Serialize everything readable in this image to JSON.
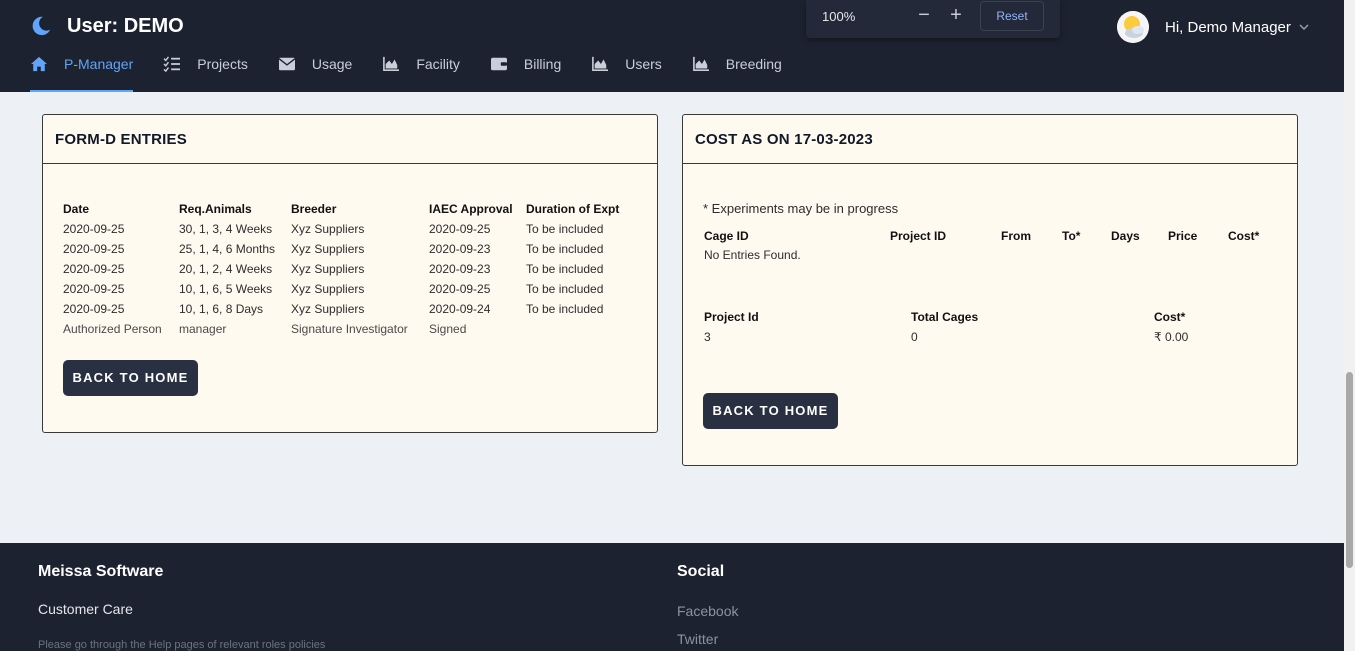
{
  "header": {
    "title": "User: DEMO",
    "greeting": "Hi, Demo Manager"
  },
  "zoom": {
    "value": "100%",
    "minus": "−",
    "plus": "+",
    "reset": "Reset"
  },
  "nav": {
    "items": [
      {
        "label": "P-Manager",
        "icon": "home-icon"
      },
      {
        "label": "Projects",
        "icon": "checklist-icon"
      },
      {
        "label": "Usage",
        "icon": "envelope-icon"
      },
      {
        "label": "Facility",
        "icon": "area-chart-icon"
      },
      {
        "label": "Billing",
        "icon": "wallet-icon"
      },
      {
        "label": "Users",
        "icon": "area-chart-icon"
      },
      {
        "label": "Breeding",
        "icon": "area-chart-icon"
      }
    ]
  },
  "form_d": {
    "title": "FORM-D ENTRIES",
    "columns": [
      "Date",
      "Req.Animals",
      "Breeder",
      "IAEC Approval",
      "Duration of Expt"
    ],
    "rows": [
      [
        "2020-09-25",
        "30, 1, 3, 4 Weeks",
        "Xyz Suppliers",
        "2020-09-25",
        "To be included"
      ],
      [
        "2020-09-25",
        "25, 1, 4, 6 Months",
        "Xyz Suppliers",
        "2020-09-23",
        "To be included"
      ],
      [
        "2020-09-25",
        "20, 1, 2, 4 Weeks",
        "Xyz Suppliers",
        "2020-09-23",
        "To be included"
      ],
      [
        "2020-09-25",
        "10, 1, 6, 5 Weeks",
        "Xyz Suppliers",
        "2020-09-25",
        "To be included"
      ],
      [
        "2020-09-25",
        "10, 1, 6, 8 Days",
        "Xyz Suppliers",
        "2020-09-24",
        "To be included"
      ]
    ],
    "auth_row": [
      "Authorized Person",
      "manager",
      "Signature Investigator",
      "Signed",
      ""
    ],
    "button": "BACK TO HOME"
  },
  "cost": {
    "title": "COST AS ON 17-03-2023",
    "note": "* Experiments may be in progress",
    "columns": [
      "Cage ID",
      "Project ID",
      "From",
      "To*",
      "Days",
      "Price",
      "Cost*"
    ],
    "empty": "No Entries Found.",
    "summary_columns": [
      "Project Id",
      "Total Cages",
      "Cost*"
    ],
    "summary_row": [
      "3",
      "0",
      "₹ 0.00"
    ],
    "button": "BACK TO HOME"
  },
  "footer": {
    "company": "Meissa Software",
    "customer_care": "Customer Care",
    "help_text": "Please go through the Help pages of relevant roles policies",
    "social_title": "Social",
    "links": [
      "Facebook",
      "Twitter"
    ]
  },
  "colors": {
    "accent": "#60a5fa",
    "header_bg": "#1c2230",
    "card_bg": "#fffaf0",
    "button_bg": "#283042"
  }
}
